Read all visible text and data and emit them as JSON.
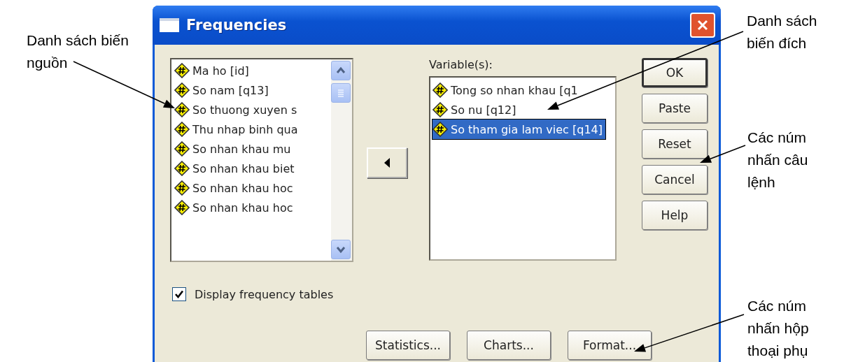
{
  "window": {
    "title": "Frequencies"
  },
  "source_list": {
    "items": [
      {
        "label": "Ma ho [id]",
        "selected": false
      },
      {
        "label": "So nam [q13]",
        "selected": false
      },
      {
        "label": "So thuong xuyen s",
        "selected": false
      },
      {
        "label": "Thu nhap binh qua",
        "selected": false
      },
      {
        "label": "So nhan khau mu",
        "selected": false
      },
      {
        "label": "So nhan khau biet",
        "selected": false
      },
      {
        "label": "So nhan khau hoc",
        "selected": false
      },
      {
        "label": "So nhan khau hoc",
        "selected": false
      }
    ]
  },
  "target_list": {
    "label": "Variable(s):",
    "items": [
      {
        "label": "Tong so nhan khau [q1",
        "selected": false
      },
      {
        "label": "So nu [q12]",
        "selected": false
      },
      {
        "label": "So tham gia lam viec [q14]",
        "selected": true
      }
    ]
  },
  "buttons": [
    {
      "label": "OK",
      "default": true
    },
    {
      "label": "Paste",
      "default": false
    },
    {
      "label": "Reset",
      "default": false
    },
    {
      "label": "Cancel",
      "default": false
    },
    {
      "label": "Help",
      "default": false
    }
  ],
  "display_frequency_tables": {
    "label": "Display frequency tables",
    "checked": true
  },
  "dialog_buttons": [
    "Statistics...",
    "Charts...",
    "Format..."
  ],
  "annotations": [
    {
      "lines": [
        "Danh sách biến",
        "nguồn"
      ]
    },
    {
      "lines": [
        "Danh sách",
        "biến đích"
      ]
    },
    {
      "lines": [
        "Các núm",
        "nhấn câu",
        "lệnh"
      ]
    },
    {
      "lines": [
        "Các núm",
        "nhấn hộp",
        "thoại phụ"
      ]
    }
  ]
}
